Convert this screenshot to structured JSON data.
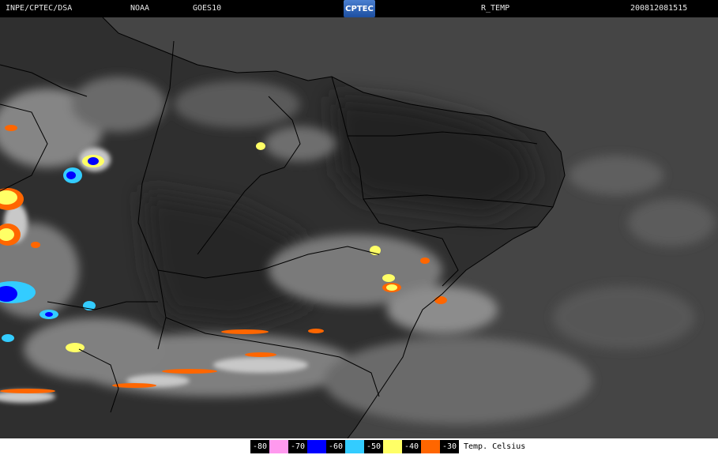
{
  "header": {
    "source": "INPE/CPTEC/DSA",
    "agency": "NOAA",
    "satellite": "GOES10",
    "logo_text": "CPTEC",
    "product": "R_TEMP",
    "timestamp": "200812081515"
  },
  "legend": {
    "items": [
      {
        "label": "-80",
        "color": "#ff99ee"
      },
      {
        "label": "-70",
        "color": "#0000ff"
      },
      {
        "label": "-60",
        "color": "#33ccff"
      },
      {
        "label": "-50",
        "color": "#ffff66"
      },
      {
        "label": "-40",
        "color": "#ff6600"
      },
      {
        "label": "-30",
        "color": ""
      }
    ],
    "units": "Temp. Celsius"
  },
  "colors": {
    "ocean": "#444444",
    "land": "#303030",
    "border": "#000000"
  }
}
